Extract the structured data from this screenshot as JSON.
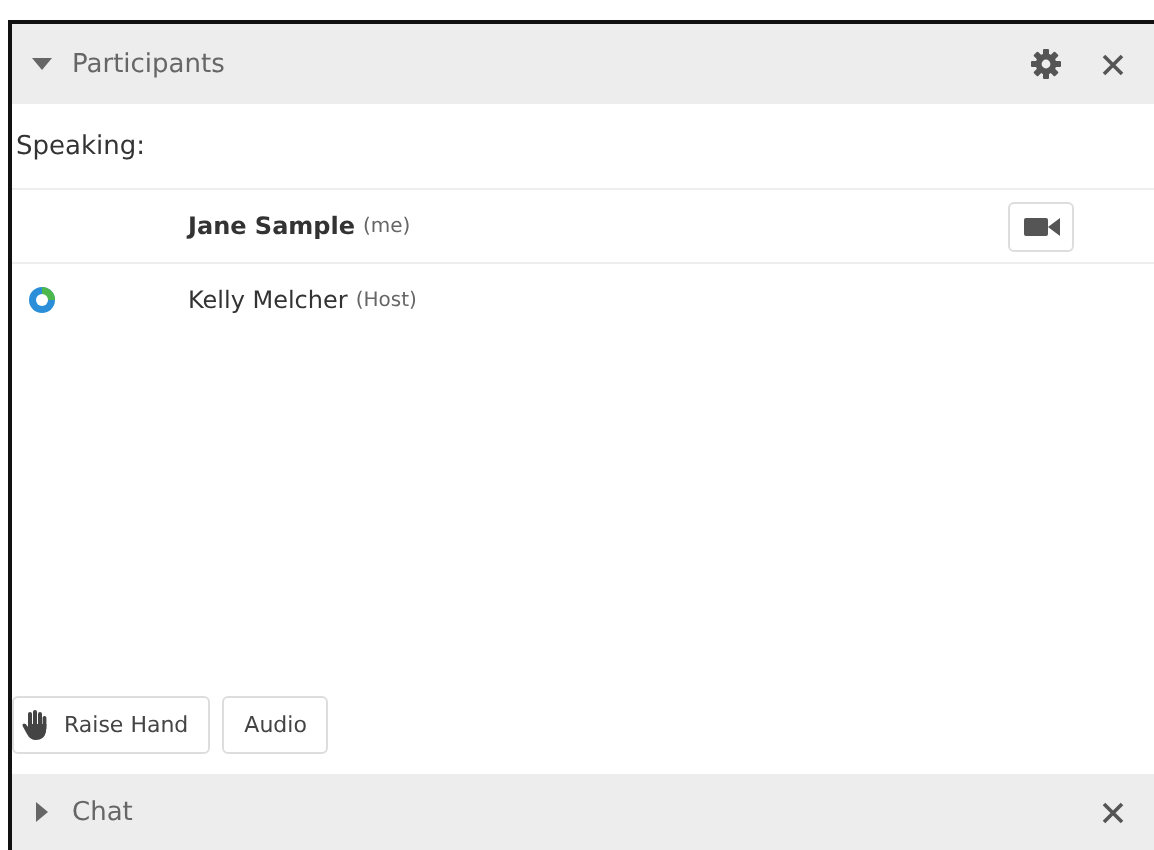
{
  "participants_panel": {
    "title": "Participants",
    "expanded": true,
    "speaking_label": "Speaking:",
    "participants": [
      {
        "name": "Jane Sample",
        "tag": "(me)",
        "kind": "self"
      },
      {
        "name": "Kelly Melcher",
        "tag": "(Host)",
        "kind": "host"
      }
    ],
    "buttons": [
      {
        "label": "Raise Hand",
        "kind": "hand"
      },
      {
        "label": "Audio",
        "kind": "plain"
      }
    ]
  },
  "chat_panel": {
    "title": "Chat",
    "expanded": false
  }
}
